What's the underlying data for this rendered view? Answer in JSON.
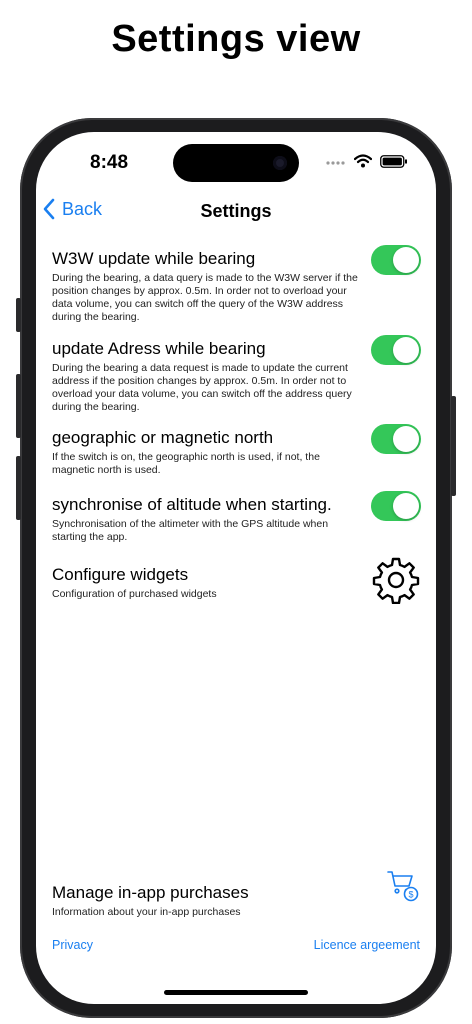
{
  "headline": "Settings view",
  "status": {
    "time": "8:48"
  },
  "nav": {
    "back_label": "Back",
    "title": "Settings"
  },
  "settings": [
    {
      "title": "W3W update while bearing",
      "description": "During the bearing, a data query is made to the W3W server if the position changes by approx. 0.5m. In order not to overload your data volume, you can switch off the query of the W3W address during the bearing.",
      "enabled": true
    },
    {
      "title": "update Adress while bearing",
      "description": "During the bearing a data request is made to update the current address if the position changes by approx. 0.5m. In order not to overload your data volume, you can switch off the address query during the bearing.",
      "enabled": true
    },
    {
      "title": "geographic or magnetic north",
      "description": "If the switch is on, the geographic north is used, if not, the magnetic north is used.",
      "enabled": true
    },
    {
      "title": "synchronise of altitude when starting.",
      "description": "Synchronisation of the altimeter with the GPS altitude when starting the app.",
      "enabled": true
    }
  ],
  "widgets": {
    "title": "Configure widgets",
    "description": "Configuration of purchased widgets",
    "icon": "gear-icon"
  },
  "purchases": {
    "title": "Manage in-app purchases",
    "description": "Information about your in-app purchases",
    "icon": "shopping-cart-dollar-icon"
  },
  "links": {
    "privacy": "Privacy",
    "licence": "Licence argeement"
  },
  "colors": {
    "accent": "#1a7ff0",
    "toggle_on": "#34c759"
  }
}
